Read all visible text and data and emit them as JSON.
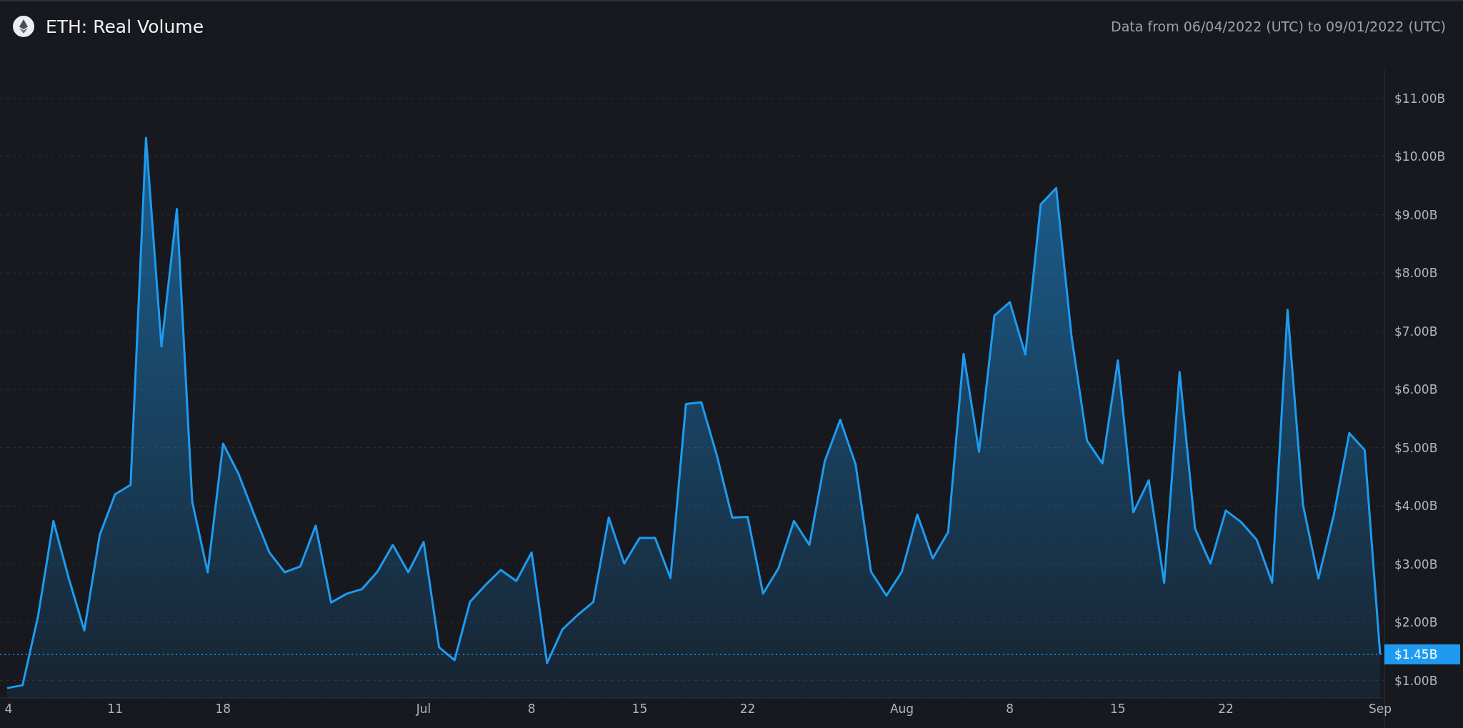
{
  "header": {
    "title": "ETH: Real Volume",
    "date_range": "Data from 06/04/2022 (UTC) to 09/01/2022 (UTC)"
  },
  "chart": {
    "chart_data": {
      "type": "area",
      "grid": true,
      "ref_lines": [
        {
          "axis": "y",
          "value": 1.45,
          "color": "#1e9bf0",
          "label": "$1.45B"
        }
      ],
      "categories": [
        "4",
        null,
        null,
        null,
        null,
        null,
        null,
        "11",
        null,
        null,
        null,
        null,
        null,
        null,
        "18",
        null,
        null,
        null,
        null,
        null,
        null,
        null,
        null,
        null,
        null,
        null,
        null,
        "Jul",
        null,
        null,
        null,
        null,
        null,
        null,
        "8",
        null,
        null,
        null,
        null,
        null,
        null,
        "15",
        null,
        null,
        null,
        null,
        null,
        null,
        "22",
        null,
        null,
        null,
        null,
        null,
        null,
        null,
        null,
        null,
        "Aug",
        null,
        null,
        null,
        null,
        null,
        null,
        "8",
        null,
        null,
        null,
        null,
        null,
        null,
        "15",
        null,
        null,
        null,
        null,
        null,
        null,
        "22",
        null,
        null,
        null,
        null,
        null,
        null,
        null,
        null,
        null,
        "Sep"
      ],
      "series": [
        {
          "color": "#1e9bf0",
          "values": [
            0.87,
            0.92,
            2.1,
            3.74,
            2.75,
            1.86,
            3.5,
            4.2,
            4.36,
            10.32,
            6.74,
            9.1,
            4.07,
            2.86,
            5.07,
            4.55,
            3.86,
            3.2,
            2.86,
            2.96,
            3.66,
            2.34,
            2.49,
            2.57,
            2.87,
            3.33,
            2.86,
            3.38,
            1.57,
            1.35,
            2.35,
            2.64,
            2.9,
            2.71,
            3.2,
            1.3,
            1.88,
            2.13,
            2.35,
            3.8,
            3.01,
            3.45,
            3.45,
            2.76,
            5.75,
            5.78,
            4.87,
            3.8,
            3.81,
            2.49,
            2.93,
            3.74,
            3.33,
            4.77,
            5.48,
            4.71,
            2.87,
            2.46,
            2.87,
            3.85,
            3.1,
            3.55,
            6.61,
            4.93,
            7.27,
            7.5,
            6.6,
            9.18,
            9.46,
            6.9,
            5.12,
            4.73,
            6.5,
            3.89,
            4.44,
            2.68,
            6.3,
            3.61,
            3.01,
            3.92,
            3.72,
            3.42,
            2.68,
            7.37,
            4.02,
            2.75,
            3.85,
            5.25,
            4.96,
            1.45
          ]
        }
      ],
      "ylim": [
        0.7,
        11.5
      ],
      "yticks": [
        {
          "value": 1,
          "label": "$1.00B"
        },
        {
          "value": 2,
          "label": "$2.00B"
        },
        {
          "value": 3,
          "label": "$3.00B"
        },
        {
          "value": 4,
          "label": "$4.00B"
        },
        {
          "value": 5,
          "label": "$5.00B"
        },
        {
          "value": 6,
          "label": "$6.00B"
        },
        {
          "value": 7,
          "label": "$7.00B"
        },
        {
          "value": 8,
          "label": "$8.00B"
        },
        {
          "value": 9,
          "label": "$9.00B"
        },
        {
          "value": 10,
          "label": "$10.00B"
        },
        {
          "value": 11,
          "label": "$11.00B"
        }
      ]
    }
  }
}
